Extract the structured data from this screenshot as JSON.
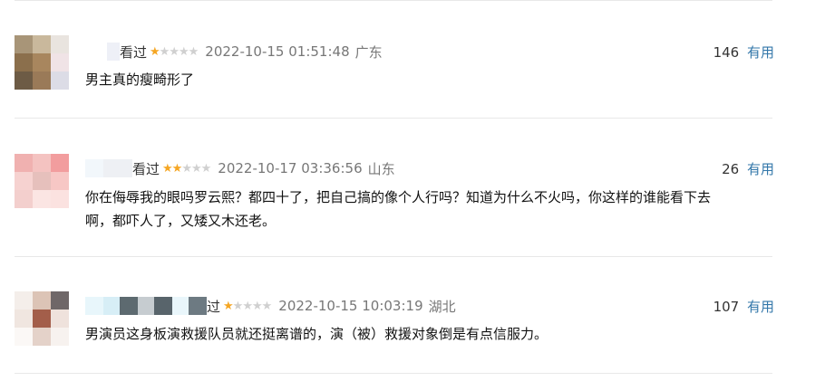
{
  "comments": [
    {
      "status": "看过",
      "stars": "★★★★★",
      "rating": 1,
      "time": "2022-10-15 01:51:48",
      "location": "广东",
      "votes": "146",
      "useful_label": "有用",
      "text": "男主真的瘦畸形了"
    },
    {
      "status": "看过",
      "stars": "★★★★★",
      "rating": 2,
      "time": "2022-10-17 03:36:56",
      "location": "山东",
      "votes": "26",
      "useful_label": "有用",
      "text_line1": "你在侮辱我的眼吗罗云熙？都四十了，把自己搞的像个人行吗？知道为什么不火吗，你这样的谁能看下去",
      "text_line2": "啊，都吓人了，又矮又木还老。"
    },
    {
      "status": "过",
      "stars": "★★★★★",
      "rating": 1,
      "time": "2022-10-15 10:03:19",
      "location": "湖北",
      "votes": "107",
      "useful_label": "有用",
      "text": "男演员这身板演救援队员就还挺离谱的，演（被）救援对象倒是有点信服力。"
    }
  ],
  "colors": {
    "star_on": "#f5a623",
    "star_off": "#d0d0d0",
    "useful_link": "#3377aa",
    "meta_gray": "#777777"
  }
}
